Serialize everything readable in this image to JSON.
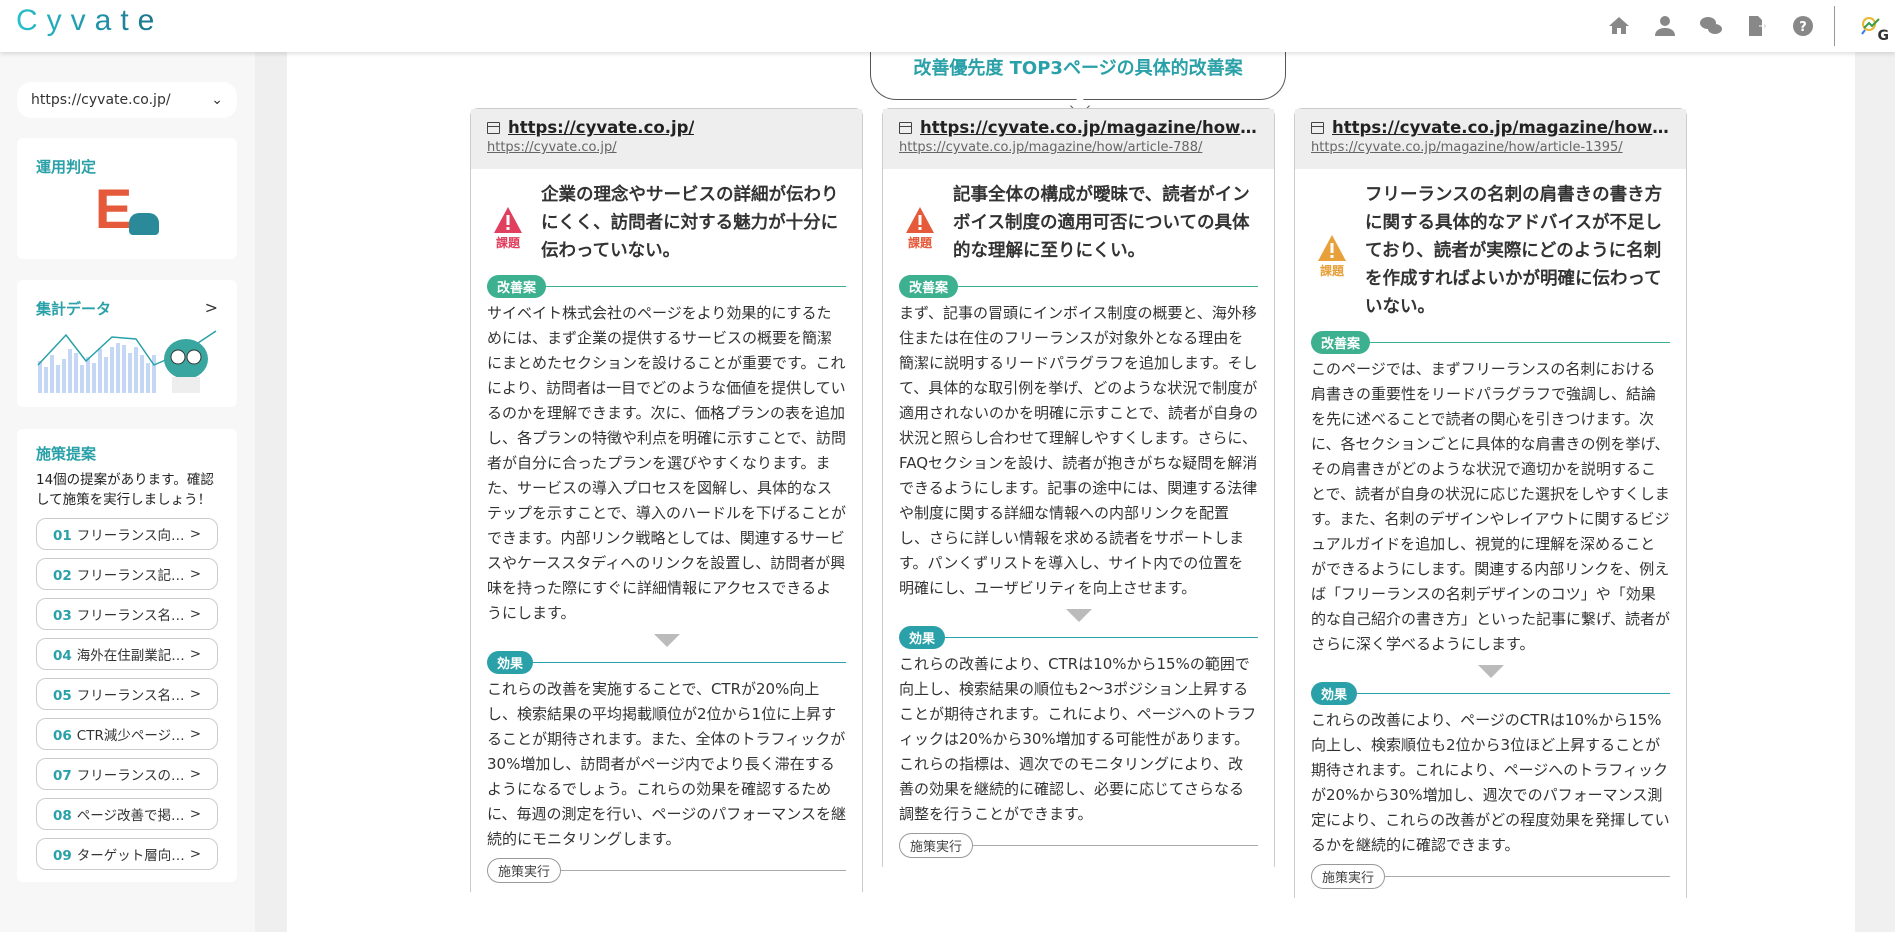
{
  "header": {
    "logo": "Cyvate",
    "icons": [
      "home-icon",
      "user-icon",
      "chat-icon",
      "logout-icon",
      "help-icon",
      "gsc-icon"
    ],
    "gsc_letter": "G"
  },
  "sidebar": {
    "site_select": "https://cyvate.co.jp/",
    "judgement": {
      "title": "運用判定",
      "grade": "E"
    },
    "stats": {
      "title": "集計データ"
    },
    "proposals": {
      "title": "施策提案",
      "description": "14個の提案があります。確認して施策を実行しましょう！",
      "items": [
        {
          "num": "01",
          "label": "フリーランス向…"
        },
        {
          "num": "02",
          "label": "フリーランス記…"
        },
        {
          "num": "03",
          "label": "フリーランス名…"
        },
        {
          "num": "04",
          "label": "海外在住副業記…"
        },
        {
          "num": "05",
          "label": "フリーランス名…"
        },
        {
          "num": "06",
          "label": "CTR減少ページ…"
        },
        {
          "num": "07",
          "label": "フリーランスの…"
        },
        {
          "num": "08",
          "label": "ページ改善で掲…"
        },
        {
          "num": "09",
          "label": "ターゲット層向…"
        }
      ]
    }
  },
  "main": {
    "bubble_title": "改善優先度 TOP3ページの具体的改善案",
    "labels": {
      "issue": "課題",
      "improvement": "改善案",
      "effect": "効果",
      "action": "施策実行"
    },
    "colors": {
      "accent": "#2aa1a8",
      "green": "#3cb08f",
      "red": "#e0405e",
      "orange_red": "#e55a3a",
      "orange": "#e8a03a"
    },
    "cards": [
      {
        "title": "https://cyvate.co.jp/",
        "url": "https://cyvate.co.jp/",
        "issue": "企業の理念やサービスの詳細が伝わりにくく、訪問者に対する魅力が十分に伝わっていない。",
        "improvement": "サイベイト株式会社のページをより効果的にするためには、まず企業の提供するサービスの概要を簡潔にまとめたセクションを設けることが重要です。これにより、訪問者は一目でどのような価値を提供しているのかを理解できます。次に、価格プランの表を追加し、各プランの特徴や利点を明確に示すことで、訪問者が自分に合ったプランを選びやすくなります。また、サービスの導入プロセスを図解し、具体的なステップを示すことで、導入のハードルを下げることができます。内部リンク戦略としては、関連するサービスやケーススタディへのリンクを設置し、訪問者が興味を持った際にすぐに詳細情報にアクセスできるようにします。",
        "effect": "これらの改善を実施することで、CTRが20%向上し、検索結果の平均掲載順位が2位から1位に上昇することが期待されます。また、全体のトラフィックが30%増加し、訪問者がページ内でより長く滞在するようになるでしょう。これらの効果を確認するために、毎週の測定を行い、ページのパフォーマンスを継続的にモニタリングします。"
      },
      {
        "title": "https://cyvate.co.jp/magazine/how/articl…",
        "url": "https://cyvate.co.jp/magazine/how/article-788/",
        "issue": "記事全体の構成が曖昧で、読者がインボイス制度の適用可否についての具体的な理解に至りにくい。",
        "improvement": "まず、記事の冒頭にインボイス制度の概要と、海外移住または在住のフリーランスが対象外となる理由を簡潔に説明するリードパラグラフを追加します。そして、具体的な取引例を挙げ、どのような状況で制度が適用されないのかを明確に示すことで、読者が自身の状況と照らし合わせて理解しやすくします。さらに、FAQセクションを設け、読者が抱きがちな疑問を解消できるようにします。記事の途中には、関連する法律や制度に関する詳細な情報への内部リンクを配置し、さらに詳しい情報を求める読者をサポートします。パンくずリストを導入し、サイト内での位置を明確にし、ユーザビリティを向上させます。",
        "effect": "これらの改善により、CTRは10%から15%の範囲で向上し、検索結果の順位も2〜3ポジション上昇することが期待されます。これにより、ページへのトラフィックは20%から30%増加する可能性があります。これらの指標は、週次でのモニタリングにより、改善の効果を継続的に確認し、必要に応じてさらなる調整を行うことができます。"
      },
      {
        "title": "https://cyvate.co.jp/magazine/how/articl…",
        "url": "https://cyvate.co.jp/magazine/how/article-1395/",
        "issue": "フリーランスの名刺の肩書きの書き方に関する具体的なアドバイスが不足しており、読者が実際にどのように名刺を作成すればよいかが明確に伝わっていない。",
        "improvement": "このページでは、まずフリーランスの名刺における肩書きの重要性をリードパラグラフで強調し、結論を先に述べることで読者の関心を引きつけます。次に、各セクションごとに具体的な肩書きの例を挙げ、その肩書きがどのような状況で適切かを説明することで、読者が自身の状況に応じた選択をしやすくします。また、名刺のデザインやレイアウトに関するビジュアルガイドを追加し、視覚的に理解を深めることができるようにします。関連する内部リンクを、例えば「フリーランスの名刺デザインのコツ」や「効果的な自己紹介の書き方」といった記事に繋げ、読者がさらに深く学べるようにします。",
        "effect": "これらの改善により、ページのCTRは10%から15%向上し、検索順位も2位から3位ほど上昇することが期待されます。これにより、ページへのトラフィックが20%から30%増加し、週次でのパフォーマンス測定により、これらの改善がどの程度効果を発揮しているかを継続的に確認できます。"
      }
    ]
  }
}
